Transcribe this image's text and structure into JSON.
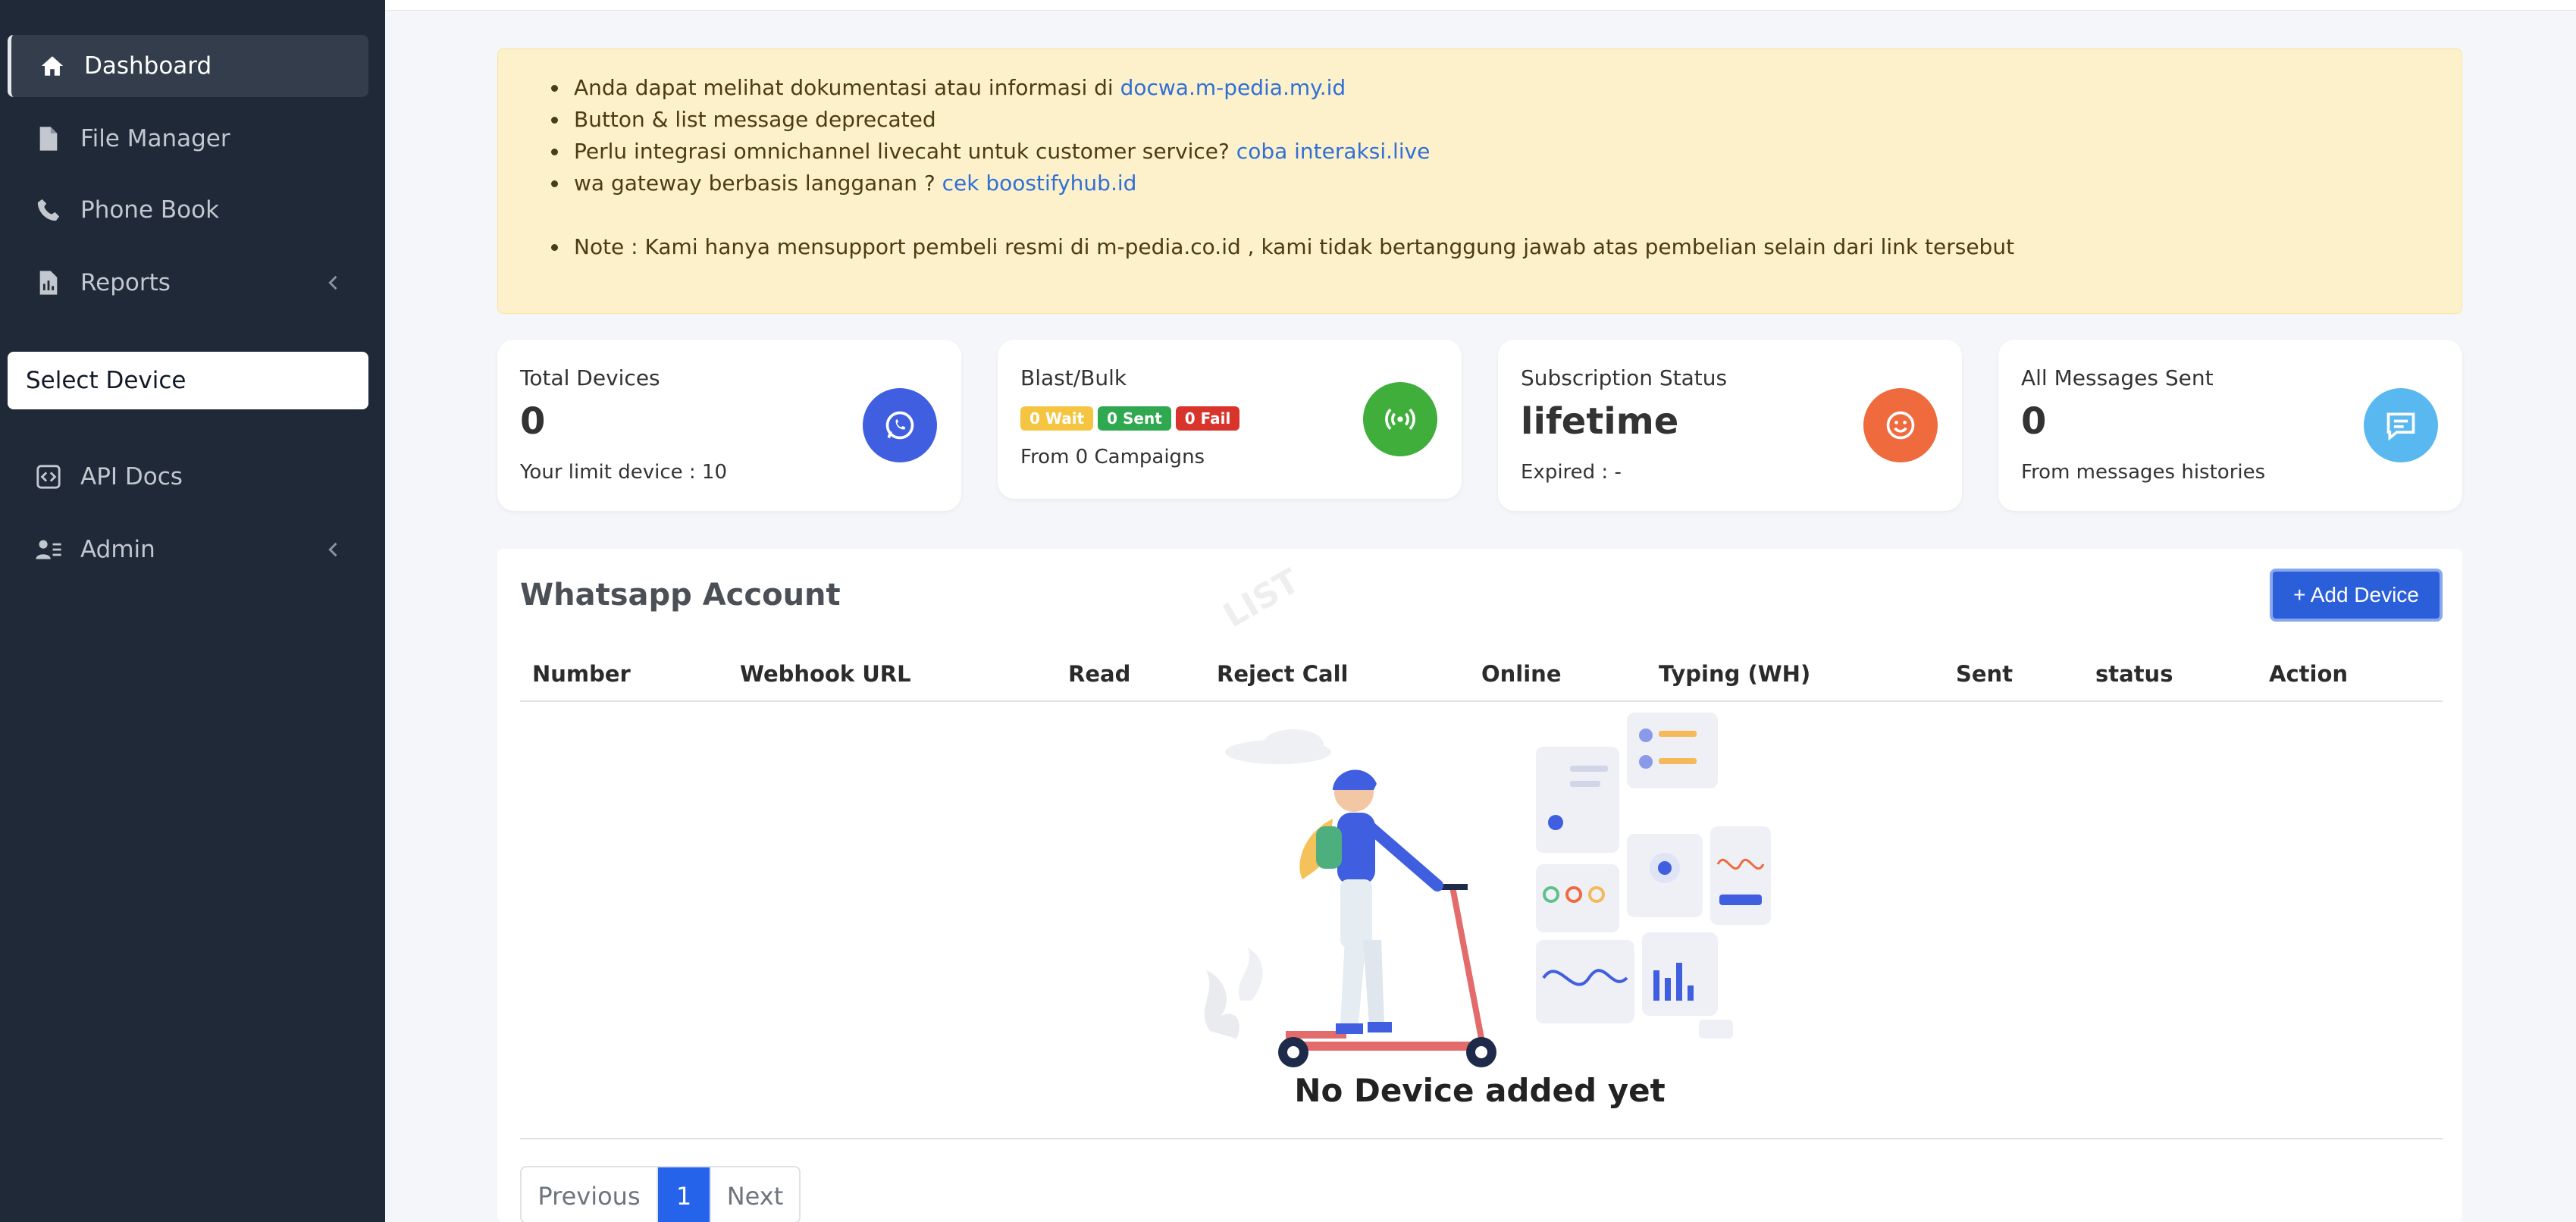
{
  "sidebar": {
    "items": [
      {
        "label": "Dashboard",
        "icon": "home-icon"
      },
      {
        "label": "File Manager",
        "icon": "file-icon"
      },
      {
        "label": "Phone Book",
        "icon": "phone-icon"
      },
      {
        "label": "Reports",
        "icon": "report-icon"
      },
      {
        "label": "API Docs",
        "icon": "code-icon"
      },
      {
        "label": "Admin",
        "icon": "users-icon"
      }
    ],
    "select_device": "Select Device"
  },
  "alert": {
    "line1_text": "Anda dapat melihat dokumentasi atau informasi di ",
    "line1_link": "docwa.m-pedia.my.id",
    "line2_text": "Button & list message deprecated",
    "line3_text": "Perlu integrasi omnichannel livecaht untuk customer service? ",
    "line3_link": "coba interaksi.live",
    "line4_text": "wa gateway berbasis langganan ? ",
    "line4_link": "cek boostifyhub.id",
    "line5_text": "Note : Kami hanya mensupport pembeli resmi di m-pedia.co.id , kami tidak bertanggung jawab atas pembelian selain dari link tersebut"
  },
  "cards": {
    "devices": {
      "label": "Total Devices",
      "value": "0",
      "sub": "Your limit device : 10",
      "color": "#3f5fe0"
    },
    "blast": {
      "label": "Blast/Bulk",
      "wait": "0 Wait",
      "sent": "0 Sent",
      "fail": "0 Fail",
      "sub": "From 0 Campaigns",
      "color": "#3fae3b"
    },
    "subscription": {
      "label": "Subscription Status",
      "value": "lifetime",
      "sub": "Expired : -",
      "color": "#ef6a3d"
    },
    "messages": {
      "label": "All Messages Sent",
      "value": "0",
      "sub": "From messages histories",
      "color": "#5ab8f0"
    }
  },
  "panel": {
    "title": "Whatsapp Account",
    "add_button": "+ Add Device",
    "columns": [
      "Number",
      "Webhook URL",
      "Read",
      "Reject Call",
      "Online",
      "Typing (WH)",
      "Sent",
      "status",
      "Action"
    ],
    "empty_text": "No Device added yet",
    "pagination": {
      "previous": "Previous",
      "current": "1",
      "next": "Next"
    }
  },
  "watermark": "LIST"
}
